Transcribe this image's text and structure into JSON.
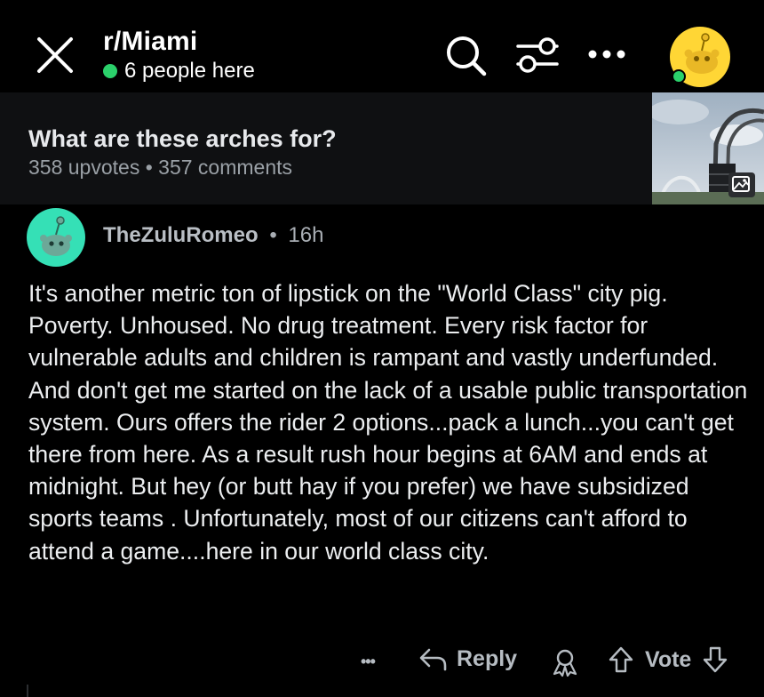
{
  "header": {
    "subreddit": "r/Miami",
    "presence": "6 people here"
  },
  "post": {
    "title": "What are these arches for?",
    "meta": "358 upvotes • 357 comments"
  },
  "comment": {
    "username": "TheZuluRomeo",
    "separator": "•",
    "age": "16h",
    "body": "It's another metric ton of lipstick on the \"World Class\" city pig. Poverty. Unhoused. No drug treatment. Every risk factor for vulnerable adults and children is rampant and vastly underfunded. And don't get me started on the lack of a usable public transportation system. Ours offers the rider 2 options...pack a lunch...you can't get there from here. As a result rush hour begins at 6AM and ends at midnight. But hey (or butt hay if you prefer) we have subsidized sports teams . Unfortunately, most of our citizens can't afford to attend a game....here in our world class city.",
    "actions": {
      "more": "•••",
      "reply": "Reply",
      "vote": "Vote"
    }
  },
  "colors": {
    "background": "#000000",
    "post_strip": "#0f1012",
    "online": "#2bd16b",
    "avatar_user": "#ffd635",
    "avatar_commenter": "#35e0b6",
    "muted_text": "#9aa0a6"
  },
  "icons": [
    "close-icon",
    "search-icon",
    "filter-icon",
    "more-icon",
    "user-avatar",
    "image-gallery-icon",
    "reply-icon",
    "award-icon",
    "upvote-icon",
    "downvote-icon"
  ]
}
